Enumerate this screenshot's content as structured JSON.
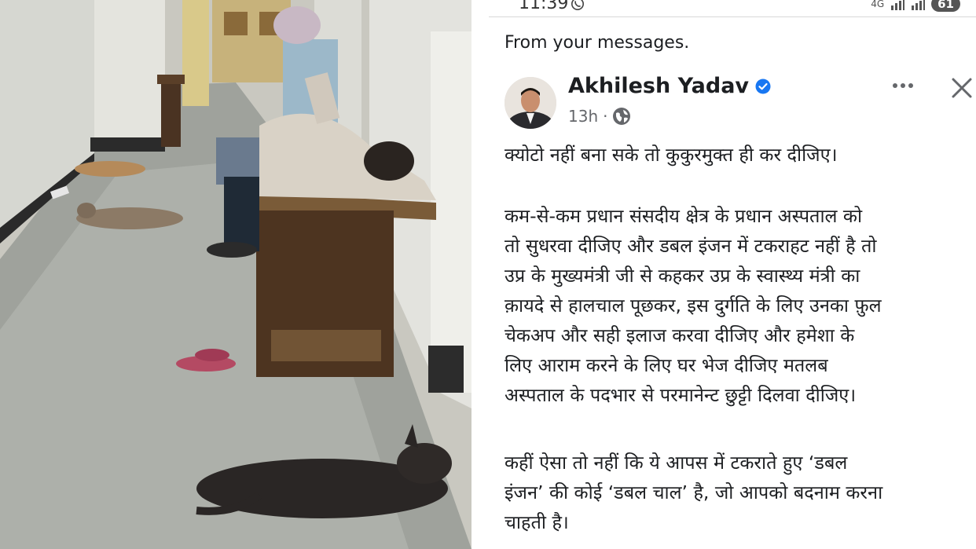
{
  "status_bar": {
    "time": "11:39",
    "battery": "61",
    "network": "4G"
  },
  "feed": {
    "header": "From your messages."
  },
  "post": {
    "author": "Akhilesh Yadav",
    "verified_color": "#1877f2",
    "time": "13h",
    "separator": "·",
    "audience_icon": "globe-icon",
    "paragraph1": [
      "क्योटो नहीं बना सके तो कुकुरमुक्त ही कर दीजिए।"
    ],
    "paragraph2": [
      "कम-से-कम प्रधान संसदीय क्षेत्र के प्रधान अस्पताल को",
      "तो सुधरवा दीजिए और डबल इंजन में टकराहट नहीं है तो",
      "उप्र के मुख्यमंत्री जी से कहकर उप्र के स्वास्थ्य मंत्री का",
      "क़ायदे से हालचाल पूछकर, इस दुर्गति के लिए उनका फ़ुल",
      "चेकअप और सही इलाज करवा दीजिए और हमेशा के",
      "लिए आराम करने के लिए घर भेज दीजिए मतलब",
      "अस्पताल के पदभार से  परमानेन्ट छुट्टी दिलवा दीजिए।"
    ],
    "paragraph3": [
      "कहीं ऐसा तो नहीं कि ये आपस में टकराते हुए ‘डबल",
      "इंजन’ की कोई ‘डबल चाल’ है, जो आपको बदनाम करना",
      "चाहती है।"
    ]
  },
  "photo": {
    "subject": "hospital corridor photo"
  }
}
